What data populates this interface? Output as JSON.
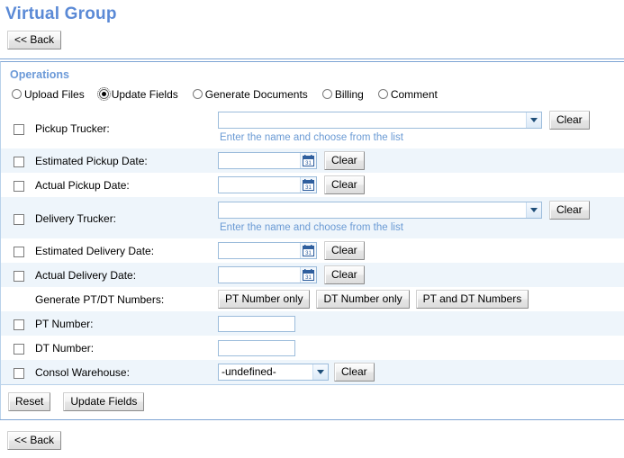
{
  "page": {
    "title": "Virtual Group",
    "title_color": "#5b8ad6",
    "accent_color": "#7fa5d4",
    "hint_color": "#6a9ad4",
    "row_alt_color": "#eef5fb"
  },
  "back_button_top": {
    "label": "<< Back"
  },
  "back_button_bottom": {
    "label": "<< Back"
  },
  "operations": {
    "header": "Operations",
    "modes": [
      {
        "label": "Upload Files",
        "checked": false
      },
      {
        "label": "Update Fields",
        "checked": true
      },
      {
        "label": "Generate Documents",
        "checked": false
      },
      {
        "label": "Billing",
        "checked": false
      },
      {
        "label": "Comment",
        "checked": false
      }
    ],
    "fields": [
      {
        "label": "Pickup Trucker:",
        "type": "combo-wide",
        "checkbox": true,
        "checked": false,
        "value": "",
        "placeholder": "",
        "hint": "Enter the name and choose from the list",
        "clear_label": "Clear"
      },
      {
        "label": "Estimated Pickup Date:",
        "type": "date",
        "checkbox": true,
        "checked": false,
        "value": "",
        "placeholder": "",
        "calendar_icon": "calendar-icon",
        "calendar_day": "31",
        "clear_label": "Clear"
      },
      {
        "label": "Actual Pickup Date:",
        "type": "date",
        "checkbox": true,
        "checked": false,
        "value": "",
        "placeholder": "",
        "calendar_icon": "calendar-icon",
        "calendar_day": "31",
        "clear_label": "Clear"
      },
      {
        "label": "Delivery Trucker:",
        "type": "combo-wide",
        "checkbox": true,
        "checked": false,
        "value": "",
        "placeholder": "",
        "hint": "Enter the name and choose from the list",
        "clear_label": "Clear"
      },
      {
        "label": "Estimated Delivery Date:",
        "type": "date",
        "checkbox": true,
        "checked": false,
        "value": "",
        "placeholder": "",
        "calendar_icon": "calendar-icon",
        "calendar_day": "31",
        "clear_label": "Clear"
      },
      {
        "label": "Actual Delivery Date:",
        "type": "date",
        "checkbox": true,
        "checked": false,
        "value": "",
        "placeholder": "",
        "calendar_icon": "calendar-icon",
        "calendar_day": "31",
        "clear_label": "Clear"
      },
      {
        "label": "Generate PT/DT Numbers:",
        "type": "buttons",
        "checkbox": false,
        "buttons": [
          "PT Number only",
          "DT Number only",
          "PT and DT Numbers"
        ]
      },
      {
        "label": "PT Number:",
        "type": "text",
        "checkbox": true,
        "checked": false,
        "value": "",
        "placeholder": ""
      },
      {
        "label": "DT Number:",
        "type": "text",
        "checkbox": true,
        "checked": false,
        "value": "",
        "placeholder": ""
      },
      {
        "label": "Consol Warehouse:",
        "type": "select",
        "checkbox": true,
        "checked": false,
        "value": "-undefined-",
        "options": [
          "-undefined-"
        ],
        "clear_label": "Clear"
      }
    ],
    "actions": {
      "reset_label": "Reset",
      "submit_label": "Update Fields"
    }
  }
}
